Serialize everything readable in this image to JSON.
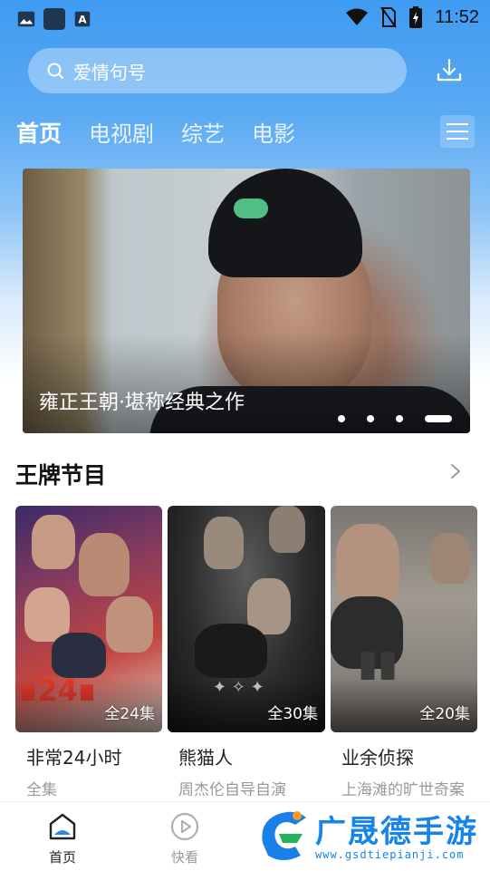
{
  "status_bar": {
    "time": "11:52",
    "icons": [
      "gallery-icon",
      "app-icon",
      "font-icon",
      "wifi-icon",
      "no-sim-icon",
      "battery-charging-icon"
    ]
  },
  "search": {
    "placeholder": "爱情句号",
    "icon": "search-icon"
  },
  "header": {
    "download_icon": "download-icon",
    "menu_icon": "menu-icon"
  },
  "tabs": [
    {
      "label": "首页",
      "active": true
    },
    {
      "label": "电视剧",
      "active": false
    },
    {
      "label": "综艺",
      "active": false
    },
    {
      "label": "电影",
      "active": false
    }
  ],
  "banner": {
    "caption": "雍正王朝·堪称经典之作",
    "slides": 4,
    "active_slide": 4
  },
  "section": {
    "title": "王牌节目",
    "more_icon": "chevron-right-icon"
  },
  "cards": [
    {
      "title": "非常24小时",
      "subtitle": "全集",
      "episodes": "全24集"
    },
    {
      "title": "熊猫人",
      "subtitle": "周杰伦自导自演",
      "episodes": "全30集"
    },
    {
      "title": "业余侦探",
      "subtitle": "上海滩的旷世奇案",
      "episodes": "全20集"
    }
  ],
  "bottom_nav": [
    {
      "label": "首页",
      "icon": "home-icon",
      "active": true
    },
    {
      "label": "快看",
      "icon": "play-circle-icon",
      "active": false
    }
  ],
  "watermark": {
    "text": "广晟德手游",
    "url": "www.gsdtiepianji.com"
  },
  "colors": {
    "accent": "#3f9bf2",
    "watermark": "#1684e8",
    "text_primary": "#111111",
    "text_secondary": "#9a9a9a"
  }
}
